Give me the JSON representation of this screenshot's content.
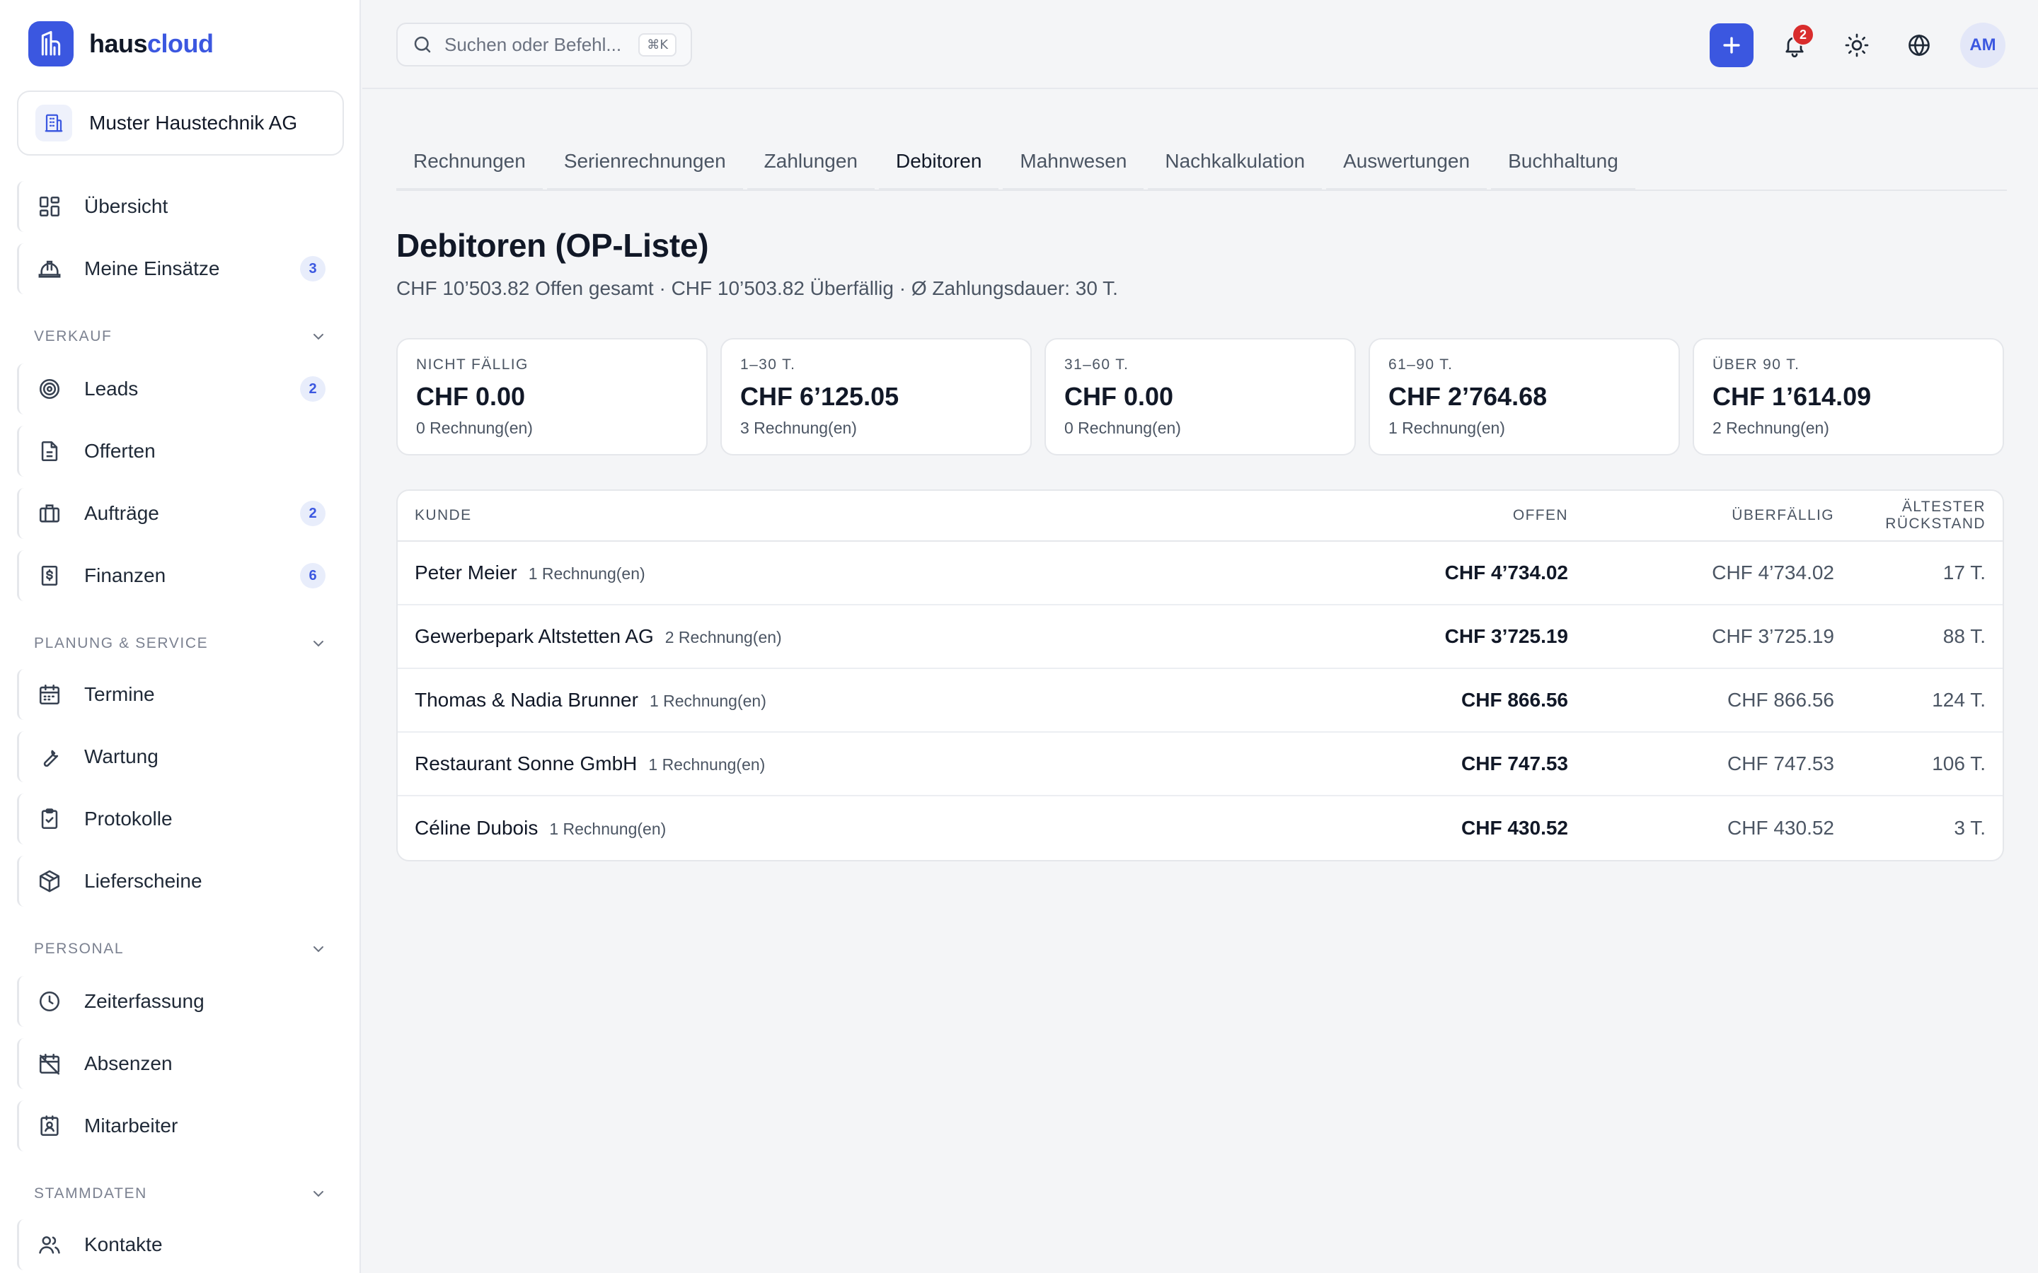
{
  "brand": {
    "name_part1": "haus",
    "name_part2": "cloud"
  },
  "company": {
    "name": "Muster Haustechnik AG"
  },
  "sidebar": {
    "top_items": [
      {
        "label": "Übersicht",
        "icon": "dashboard-icon",
        "badge": ""
      },
      {
        "label": "Meine Einsätze",
        "icon": "hardhat-icon",
        "badge": "3"
      }
    ],
    "sections": [
      {
        "label": "VERKAUF",
        "items": [
          {
            "label": "Leads",
            "icon": "target-icon",
            "badge": "2"
          },
          {
            "label": "Offerten",
            "icon": "document-icon",
            "badge": ""
          },
          {
            "label": "Aufträge",
            "icon": "briefcase-icon",
            "badge": "2"
          },
          {
            "label": "Finanzen",
            "icon": "dollar-file-icon",
            "badge": "6"
          }
        ]
      },
      {
        "label": "PLANUNG & SERVICE",
        "items": [
          {
            "label": "Termine",
            "icon": "calendar-icon",
            "badge": ""
          },
          {
            "label": "Wartung",
            "icon": "wrench-icon",
            "badge": ""
          },
          {
            "label": "Protokolle",
            "icon": "clipboard-check-icon",
            "badge": ""
          },
          {
            "label": "Lieferscheine",
            "icon": "package-icon",
            "badge": ""
          }
        ]
      },
      {
        "label": "PERSONAL",
        "items": [
          {
            "label": "Zeiterfassung",
            "icon": "clock-icon",
            "badge": ""
          },
          {
            "label": "Absenzen",
            "icon": "calendar-off-icon",
            "badge": ""
          },
          {
            "label": "Mitarbeiter",
            "icon": "contact-card-icon",
            "badge": ""
          }
        ]
      },
      {
        "label": "STAMMDATEN",
        "items": [
          {
            "label": "Kontakte",
            "icon": "users-icon",
            "badge": ""
          }
        ]
      }
    ]
  },
  "topbar": {
    "search_placeholder": "Suchen oder Befehl...",
    "search_shortcut": "⌘K",
    "notification_count": "2",
    "avatar_initials": "AM"
  },
  "tabs": [
    {
      "label": "Rechnungen",
      "active": false
    },
    {
      "label": "Serienrechnungen",
      "active": false
    },
    {
      "label": "Zahlungen",
      "active": false
    },
    {
      "label": "Debitoren",
      "active": true
    },
    {
      "label": "Mahnwesen",
      "active": false
    },
    {
      "label": "Nachkalkulation",
      "active": false
    },
    {
      "label": "Auswertungen",
      "active": false
    },
    {
      "label": "Buchhaltung",
      "active": false
    }
  ],
  "header": {
    "title": "Debitoren (OP-Liste)",
    "subtitle": "CHF 10’503.82 Offen gesamt · CHF 10’503.82 Überfällig · Ø Zahlungsdauer: 30 T."
  },
  "aging_cards": [
    {
      "label": "NICHT FÄLLIG",
      "amount": "CHF 0.00",
      "count": "0 Rechnung(en)"
    },
    {
      "label": "1–30 T.",
      "amount": "CHF 6’125.05",
      "count": "3 Rechnung(en)"
    },
    {
      "label": "31–60 T.",
      "amount": "CHF 0.00",
      "count": "0 Rechnung(en)"
    },
    {
      "label": "61–90 T.",
      "amount": "CHF 2’764.68",
      "count": "1 Rechnung(en)"
    },
    {
      "label": "ÜBER 90 T.",
      "amount": "CHF 1’614.09",
      "count": "2 Rechnung(en)"
    }
  ],
  "table": {
    "headers": {
      "kunde": "KUNDE",
      "offen": "OFFEN",
      "ueberfaellig": "ÜBERFÄLLIG",
      "aeltester": "ÄLTESTER RÜCKSTAND"
    },
    "rows": [
      {
        "kunde": "Peter Meier",
        "count": "1 Rechnung(en)",
        "offen": "CHF 4’734.02",
        "ueberfaellig": "CHF 4’734.02",
        "aeltester": "17 T."
      },
      {
        "kunde": "Gewerbepark Altstetten AG",
        "count": "2 Rechnung(en)",
        "offen": "CHF 3’725.19",
        "ueberfaellig": "CHF 3’725.19",
        "aeltester": "88 T."
      },
      {
        "kunde": "Thomas & Nadia Brunner",
        "count": "1 Rechnung(en)",
        "offen": "CHF 866.56",
        "ueberfaellig": "CHF 866.56",
        "aeltester": "124 T."
      },
      {
        "kunde": "Restaurant Sonne GmbH",
        "count": "1 Rechnung(en)",
        "offen": "CHF 747.53",
        "ueberfaellig": "CHF 747.53",
        "aeltester": "106 T."
      },
      {
        "kunde": "Céline Dubois",
        "count": "1 Rechnung(en)",
        "offen": "CHF 430.52",
        "ueberfaellig": "CHF 430.52",
        "aeltester": "3 T."
      }
    ]
  },
  "colors": {
    "accent": "#3b57e0",
    "danger": "#d92d2d"
  }
}
